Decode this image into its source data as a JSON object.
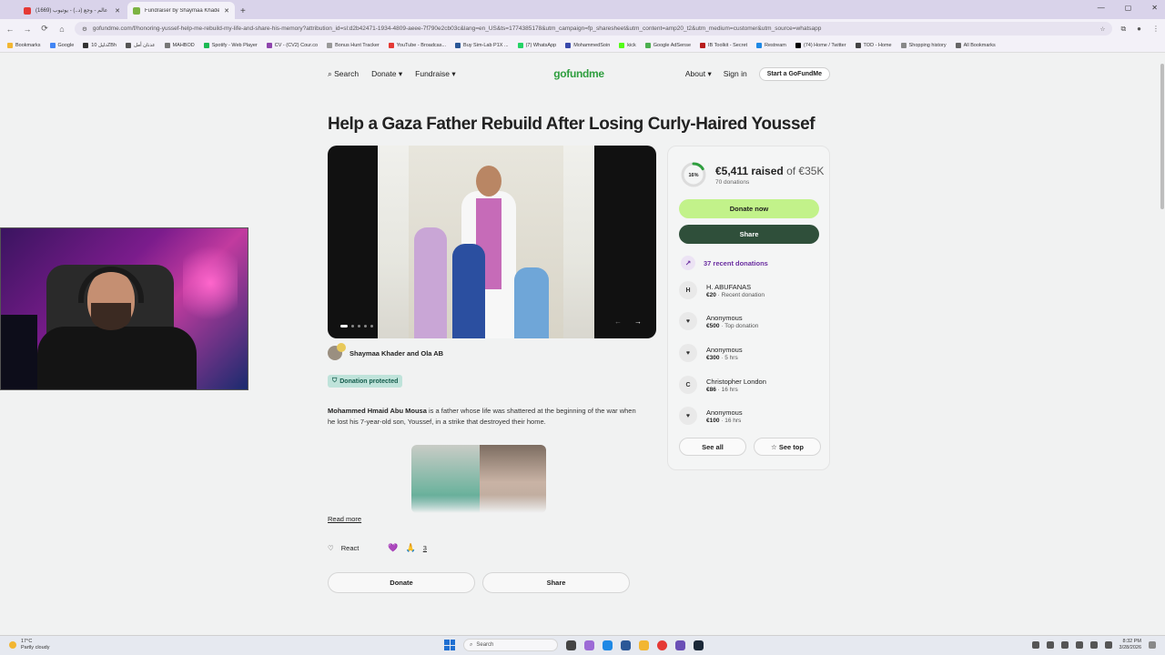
{
  "browser": {
    "tabs": [
      {
        "title": "عالم - وجع (د..) - يوتيوب (1669)",
        "favicon_color": "#e53935",
        "active": false
      },
      {
        "title": "Fundraiser by Shaymaa Khader",
        "favicon_color": "#7cb342",
        "active": true
      }
    ],
    "url": "gofundme.com/f/honoring-yussef-help-me-rebuild-my-life-and-share-his-memory?attribution_id=sl:d2b42471-1934-4809-aeee-7f790e2cb03c&lang=en_US&ts=1774385178&utm_campaign=fp_sharesheet&utm_content=amp20_t2&utm_medium=customer&utm_source=whatsapp",
    "bookmarks": [
      "Bookmarks",
      "Google",
      "دليل 10ZBh",
      "عدنان أمل",
      "MAHBOD",
      "Spotify - Web Player",
      "CV - (CV2) Cour.co",
      "Bonus Hunt Tracker",
      "YouTube - Broadcas...",
      "Buy Sim-Lab P1X ...",
      "(7) WhatsApp",
      "MohammedSoin",
      "kick",
      "Google AdSense",
      "IB Toolkit - Secret",
      "Restream",
      "(74) Home / Twitter",
      "TOD - Home",
      "Shopping history",
      "All Bookmarks"
    ]
  },
  "nav": {
    "search": "Search",
    "donate": "Donate",
    "fundraise": "Fundraise",
    "logo": "gofundme",
    "about": "About",
    "signin": "Sign in",
    "start": "Start a GoFundMe"
  },
  "campaign": {
    "title": "Help a Gaza Father Rebuild After Losing Curly-Haired Youssef",
    "organizer": "Shaymaa Khader and Ola AB",
    "protected_label": "Donation protected",
    "story_bold": "Mohammed Hmaid Abu Mousa",
    "story_rest": " is a father whose life was shattered at the beginning of the war when he lost his 7-year-old son, Youssef, in a strike that destroyed their home.",
    "read_more": "Read more",
    "react_label": "React",
    "react_count": "3",
    "donate_btn": "Donate",
    "share_btn": "Share"
  },
  "donation_card": {
    "progress_pct_label": "16%",
    "progress_fraction": 0.16,
    "raised": "€5,411 raised",
    "goal": " of €35K",
    "donations_count": "70 donations",
    "donate_now": "Donate now",
    "share": "Share",
    "recent_label": "37 recent donations",
    "donors": [
      {
        "initial": "H",
        "name": "H. ABUFANAS",
        "amount": "€20",
        "note": " · Recent donation"
      },
      {
        "initial": "",
        "name": "Anonymous",
        "amount": "€500",
        "note": " · Top donation"
      },
      {
        "initial": "",
        "name": "Anonymous",
        "amount": "€300",
        "note": " · 5 hrs"
      },
      {
        "initial": "C",
        "name": "Christopher London",
        "amount": "€86",
        "note": " · 16 hrs"
      },
      {
        "initial": "",
        "name": "Anonymous",
        "amount": "€100",
        "note": " · 16 hrs"
      }
    ],
    "see_all": "See all",
    "see_top": "See top"
  },
  "taskbar": {
    "temp": "17°C",
    "weather": "Partly cloudy",
    "search": "Search",
    "time": "8:32 PM",
    "date": "3/28/2026"
  }
}
